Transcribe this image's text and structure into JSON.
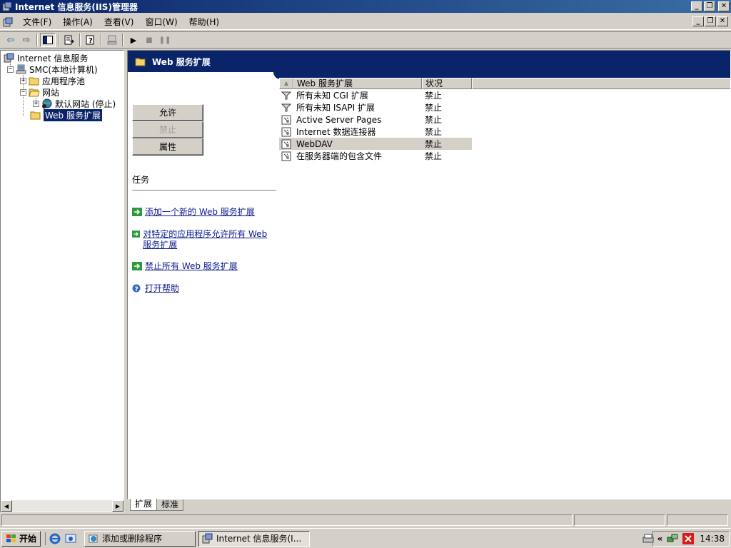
{
  "window": {
    "title": "Internet 信息服务(IIS)管理器"
  },
  "menu": {
    "items": [
      "文件(F)",
      "操作(A)",
      "查看(V)",
      "窗口(W)",
      "帮助(H)"
    ]
  },
  "tree": {
    "root": "Internet 信息服务",
    "computer": "SMC(本地计算机)",
    "app_pools": "应用程序池",
    "websites": "网站",
    "default_site": "默认网站 (停止)",
    "web_ext": "Web 服务扩展"
  },
  "result": {
    "header_title": "Web 服务扩展",
    "buttons": {
      "allow": "允许",
      "prohibit": "禁止",
      "properties": "属性"
    },
    "tasks_title": "任务",
    "tasks": [
      "添加一个新的 Web 服务扩展",
      "对特定的应用程序允许所有 Web 服务扩展",
      "禁止所有 Web 服务扩展",
      "打开帮助"
    ],
    "list": {
      "columns": {
        "name": "Web 服务扩展",
        "status": "状况"
      },
      "rows": [
        {
          "name": "所有未知 CGI 扩展",
          "status": "禁止",
          "icon": "filter-icon"
        },
        {
          "name": "所有未知 ISAPI 扩展",
          "status": "禁止",
          "icon": "filter-icon"
        },
        {
          "name": "Active Server Pages",
          "status": "禁止",
          "icon": "extension-doc-icon"
        },
        {
          "name": "Internet 数据连接器",
          "status": "禁止",
          "icon": "extension-doc-icon"
        },
        {
          "name": "WebDAV",
          "status": "禁止",
          "icon": "extension-doc-icon"
        },
        {
          "name": "在服务器端的包含文件",
          "status": "禁止",
          "icon": "extension-doc-icon"
        }
      ]
    }
  },
  "tabs": [
    "扩展",
    "标准"
  ],
  "taskbar": {
    "start": "开始",
    "windows": [
      "添加或删除程序",
      "Internet 信息服务(I..."
    ],
    "clock": "14:38"
  },
  "colors": {
    "title_bar": "#0a246a",
    "face": "#d4d0c8",
    "link": "#0b1a8e",
    "selection": "#0a246a"
  }
}
